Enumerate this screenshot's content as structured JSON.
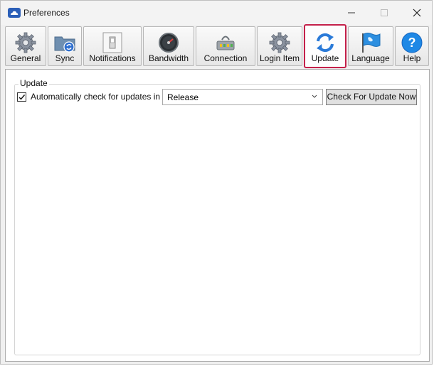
{
  "window": {
    "title": "Preferences",
    "title_icon": "cloud-icon",
    "controls": {
      "minimize": "minimize-icon",
      "maximize": "maximize-icon",
      "close": "close-icon"
    }
  },
  "toolbar": {
    "items": [
      {
        "label": "General",
        "icon": "gear-icon",
        "active": false
      },
      {
        "label": "Sync",
        "icon": "sync-folder-icon",
        "active": false
      },
      {
        "label": "Notifications",
        "icon": "toggle-switch-icon",
        "active": false
      },
      {
        "label": "Bandwidth",
        "icon": "speedometer-icon",
        "active": false
      },
      {
        "label": "Connection",
        "icon": "network-icon",
        "active": false
      },
      {
        "label": "Login Item",
        "icon": "gear-icon",
        "active": false
      },
      {
        "label": "Update",
        "icon": "refresh-icon",
        "active": true
      },
      {
        "label": "Language",
        "icon": "flag-icon",
        "active": false
      },
      {
        "label": "Help",
        "icon": "help-icon",
        "active": false
      }
    ],
    "active_color": "#c4204a"
  },
  "update_panel": {
    "group_title": "Update",
    "auto_check": {
      "label": "Automatically check for updates in",
      "checked": true
    },
    "channel_select": {
      "value": "Release"
    },
    "check_button": "Check For Update Now"
  }
}
